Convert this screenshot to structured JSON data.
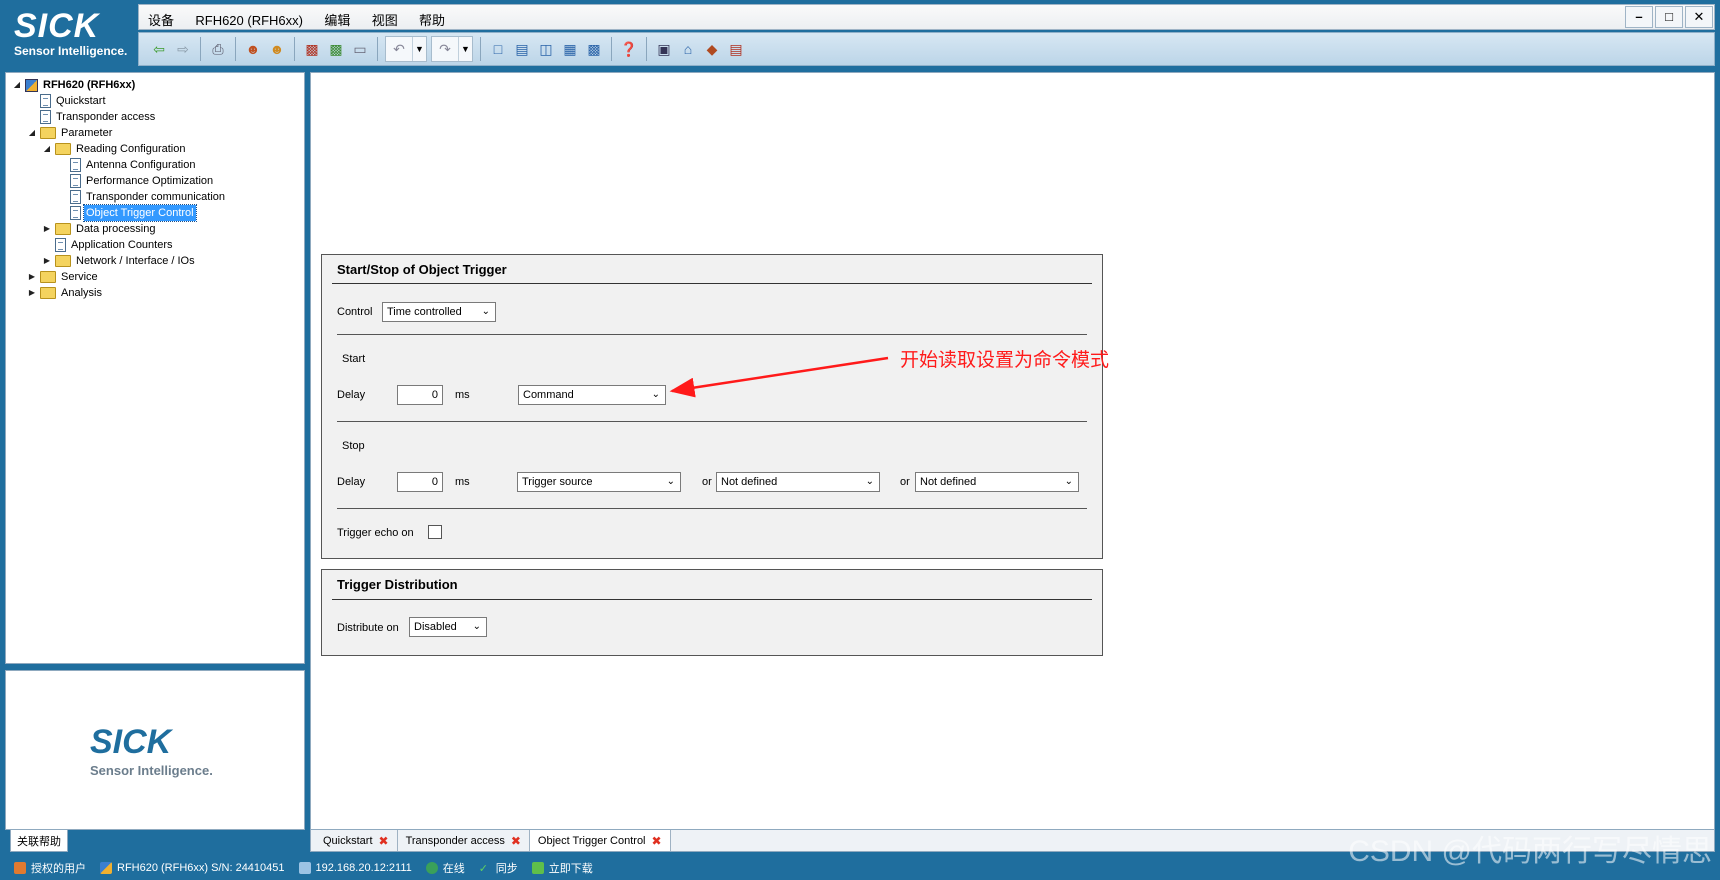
{
  "logo": {
    "brand": "SICK",
    "tagline": "Sensor Intelligence."
  },
  "menubar": {
    "items": [
      "设备",
      "RFH620 (RFH6xx)",
      "编辑",
      "视图",
      "帮助"
    ]
  },
  "window_controls": [
    "minimize",
    "maximize",
    "close"
  ],
  "toolbar": {
    "icons": [
      "back-icon",
      "forward-icon",
      "print-icon",
      "user-login-icon",
      "user-logout-icon",
      "load-file-icon",
      "save-file-icon",
      "eraser-icon",
      "undo-icon",
      "redo-icon",
      "layout-single-icon",
      "layout-split-h-icon",
      "layout-split-v-icon",
      "layout-quad-icon",
      "layout-grid-icon",
      "help-icon",
      "monitor-icon",
      "home-icon",
      "device-icon",
      "export-icon"
    ]
  },
  "tree": [
    {
      "label": "RFH620 (RFH6xx)",
      "level": 0,
      "icon": "device-icon",
      "toggle": "expanded",
      "bold": true
    },
    {
      "label": "Quickstart",
      "level": 1,
      "icon": "page-icon",
      "toggle": "none"
    },
    {
      "label": "Transponder access",
      "level": 1,
      "icon": "page-icon",
      "toggle": "none"
    },
    {
      "label": "Parameter",
      "level": 1,
      "icon": "folder-open-icon",
      "toggle": "expanded"
    },
    {
      "label": "Reading Configuration",
      "level": 2,
      "icon": "folder-open-icon",
      "toggle": "expanded"
    },
    {
      "label": "Antenna Configuration",
      "level": 3,
      "icon": "page-icon",
      "toggle": "none"
    },
    {
      "label": "Performance Optimization",
      "level": 3,
      "icon": "page-icon",
      "toggle": "none"
    },
    {
      "label": "Transponder communication",
      "level": 3,
      "icon": "page-icon",
      "toggle": "none"
    },
    {
      "label": "Object Trigger Control",
      "level": 3,
      "icon": "page-icon",
      "toggle": "none",
      "selected": true
    },
    {
      "label": "Data processing",
      "level": 2,
      "icon": "folder-icon",
      "toggle": "collapsed"
    },
    {
      "label": "Application Counters",
      "level": 2,
      "icon": "page-icon",
      "toggle": "none"
    },
    {
      "label": "Network / Interface / IOs",
      "level": 2,
      "icon": "folder-icon",
      "toggle": "collapsed"
    },
    {
      "label": "Service",
      "level": 1,
      "icon": "folder-icon",
      "toggle": "collapsed"
    },
    {
      "label": "Analysis",
      "level": 1,
      "icon": "folder-icon",
      "toggle": "collapsed"
    }
  ],
  "help_tab": "关联帮助",
  "trigger_group": {
    "title": "Start/Stop of Object Trigger",
    "control_label": "Control",
    "control_value": "Time controlled",
    "start_label": "Start",
    "start_delay_label": "Delay",
    "start_delay_value": "0",
    "start_unit": "ms",
    "start_mode_value": "Command",
    "stop_label": "Stop",
    "stop_delay_label": "Delay",
    "stop_delay_value": "0",
    "stop_unit": "ms",
    "stop_source_value": "Trigger source",
    "or_label_1": "or",
    "stop_source_2_value": "Not defined",
    "or_label_2": "or",
    "stop_source_3_value": "Not defined",
    "echo_label": "Trigger echo on",
    "echo_checked": false
  },
  "distribution_group": {
    "title": "Trigger Distribution",
    "distribute_label": "Distribute on",
    "distribute_value": "Disabled"
  },
  "annotation": {
    "text": "开始读取设置为命令模式",
    "color": "#ff1a1a"
  },
  "doc_tabs": [
    {
      "label": "Quickstart",
      "closable": true,
      "active": false
    },
    {
      "label": "Transponder access",
      "closable": true,
      "active": false
    },
    {
      "label": "Object Trigger Control",
      "closable": true,
      "active": true
    }
  ],
  "statusbar": {
    "user": "授权的用户",
    "device": "RFH620 (RFH6xx) S/N: 24410451",
    "address": "192.168.20.12:2111",
    "online": "在线",
    "sync": "同步",
    "download": "立即下载"
  },
  "watermark": "CSDN @代码两行写尽情思",
  "colors": {
    "frame": "#1f6e9e",
    "selection": "#3399ff",
    "annotation": "#ff1a1a"
  }
}
